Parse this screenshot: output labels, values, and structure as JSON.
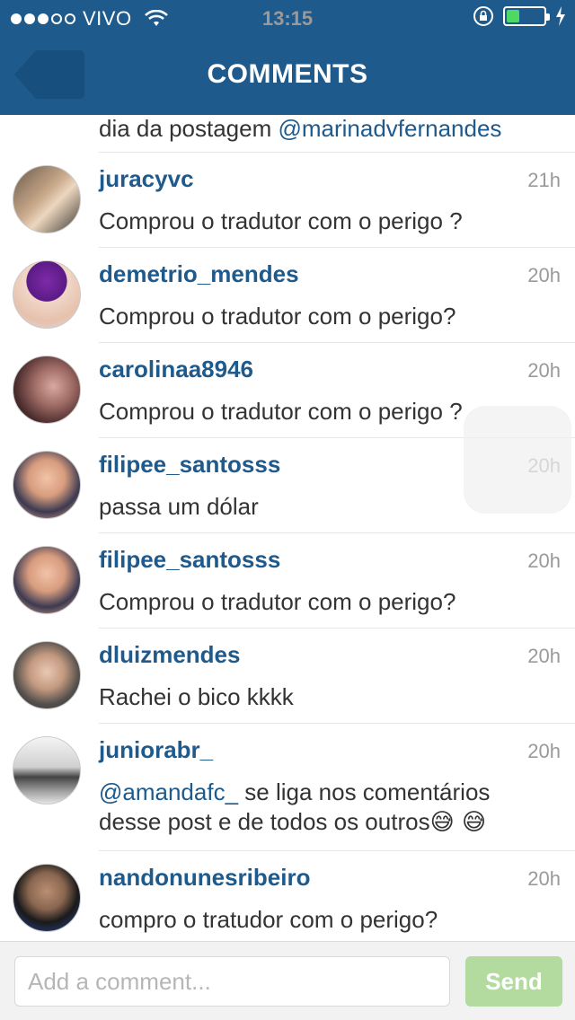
{
  "status": {
    "carrier": "VIVO",
    "time": "13:15"
  },
  "nav": {
    "title": "COMMENTS"
  },
  "partial": {
    "text_prefix": "dia da postagem ",
    "mention": "@marinadvfernandes"
  },
  "comments": [
    {
      "username": "juracyvc",
      "time": "21h",
      "text": "Comprou o tradutor com o perigo ?"
    },
    {
      "username": "demetrio_mendes",
      "time": "20h",
      "text": "Comprou o tradutor com o perigo?"
    },
    {
      "username": "carolinaa8946",
      "time": "20h",
      "text": "Comprou o tradutor com o perigo ?"
    },
    {
      "username": "filipee_santosss",
      "time": "20h",
      "text": "passa um dólar"
    },
    {
      "username": "filipee_santosss",
      "time": "20h",
      "text": "Comprou o tradutor com o perigo?"
    },
    {
      "username": "dluizmendes",
      "time": "20h",
      "text": "Rachei o bico kkkk"
    },
    {
      "username": "juniorabr_",
      "time": "20h",
      "mention": "@amandafc_",
      "text_after": " se liga nos comentários desse post e de todos os outros",
      "emoji": "😅 😅"
    },
    {
      "username": "nandonunesribeiro",
      "time": "20h",
      "text": "compro o tratudor com o perigo?"
    }
  ],
  "composer": {
    "placeholder": "Add a comment...",
    "send_label": "Send"
  },
  "colors": {
    "header": "#1e5a8c",
    "username": "#1e5a8c",
    "send_disabled": "#b3dba0",
    "battery": "#4cd964"
  },
  "icons": [
    "wifi-icon",
    "orientation-lock-icon",
    "battery-icon",
    "charging-bolt-icon",
    "back-arrow-icon"
  ]
}
